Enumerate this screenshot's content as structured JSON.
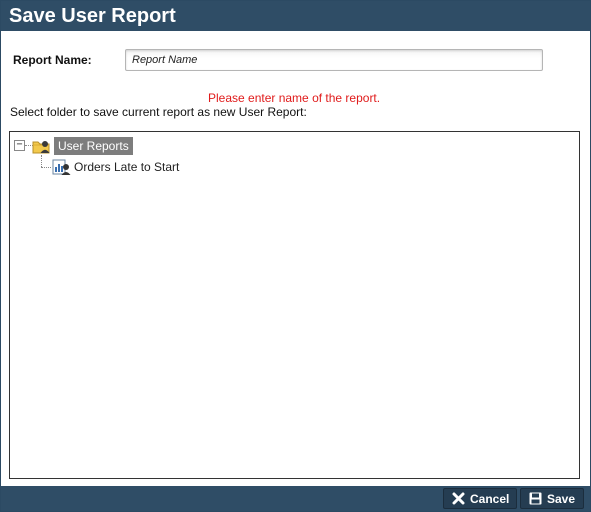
{
  "dialog": {
    "title": "Save User Report"
  },
  "form": {
    "report_name_label": "Report Name:",
    "report_name_value": "Report Name",
    "error_message": "Please enter name of the report.",
    "instruction": "Select folder to save current report as new User Report:"
  },
  "tree": {
    "root": {
      "label": "User Reports",
      "expander": "−",
      "icon": "user-folder-icon",
      "selected": true
    },
    "children": [
      {
        "label": "Orders Late to Start",
        "icon": "user-report-icon"
      }
    ]
  },
  "footer": {
    "cancel_label": "Cancel",
    "cancel_icon": "close-x-icon",
    "save_label": "Save",
    "save_icon": "floppy-disk-icon"
  },
  "colors": {
    "titlebar": "#2f4d66",
    "error": "#e01b1b",
    "selection": "#7d7d7d"
  }
}
